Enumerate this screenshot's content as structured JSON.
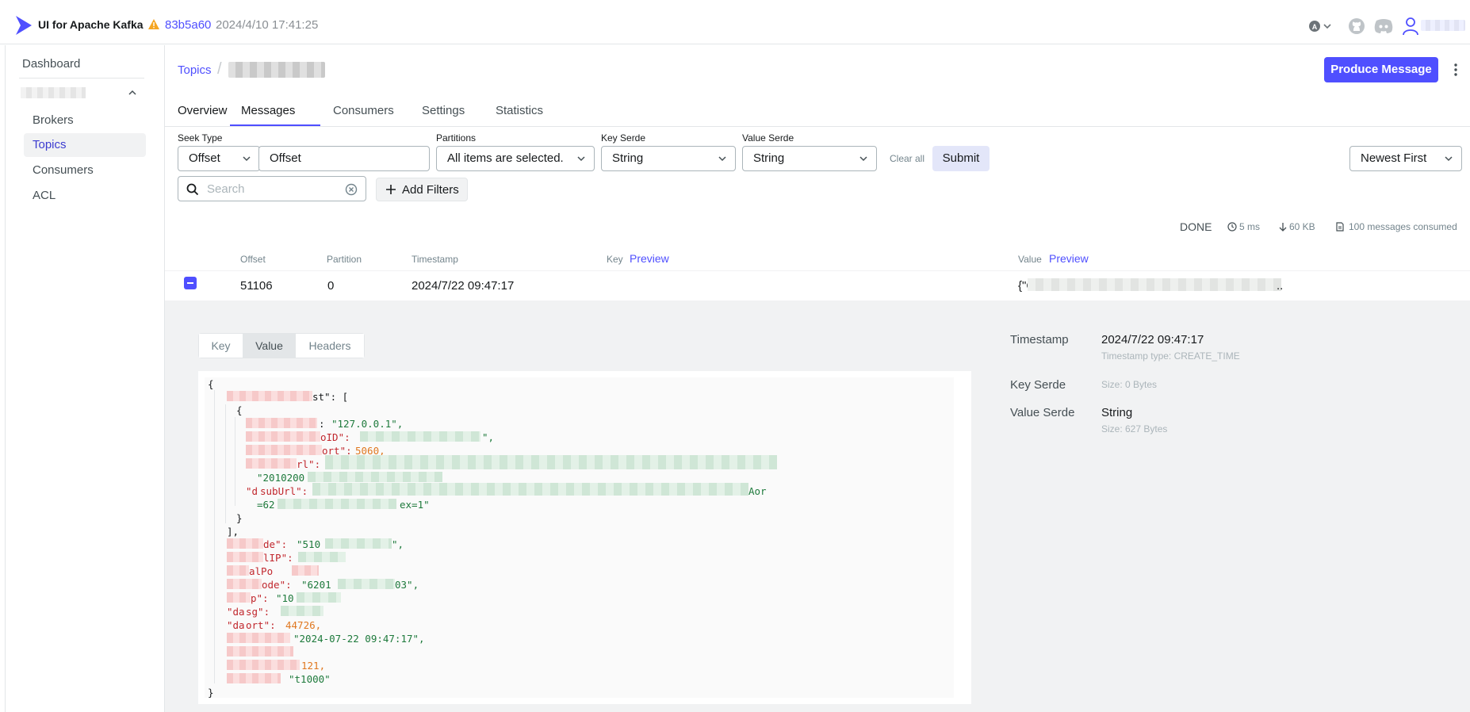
{
  "header": {
    "app_title": "UI for Apache Kafka",
    "commit": "83b5a60",
    "build_date": "2024/4/10 17:41:25",
    "theme_badge": "A"
  },
  "sidebar": {
    "dashboard": "Dashboard",
    "items": [
      {
        "label": "Brokers",
        "active": false
      },
      {
        "label": "Topics",
        "active": true
      },
      {
        "label": "Consumers",
        "active": false
      },
      {
        "label": "ACL",
        "active": false
      }
    ]
  },
  "breadcrumb": {
    "parent": "Topics",
    "separator": "/"
  },
  "actions": {
    "produce": "Produce Message"
  },
  "tabs": [
    {
      "label": "Overview",
      "active": false
    },
    {
      "label": "Messages",
      "active": true
    },
    {
      "label": "Consumers",
      "active": false
    },
    {
      "label": "Settings",
      "active": false
    },
    {
      "label": "Statistics",
      "active": false
    }
  ],
  "filters": {
    "seek_type_label": "Seek Type",
    "seek_type_value": "Offset",
    "seek_input_placeholder": "Offset",
    "partitions_label": "Partitions",
    "partitions_value": "All items are selected.",
    "key_serde_label": "Key Serde",
    "key_serde_value": "String",
    "value_serde_label": "Value Serde",
    "value_serde_value": "String",
    "clear_all": "Clear all",
    "submit": "Submit",
    "sort": "Newest First",
    "search_placeholder": "Search",
    "add_filters": "Add Filters"
  },
  "stats": {
    "status": "DONE",
    "elapsed": "5 ms",
    "size": "60 KB",
    "consumed": "100 messages consumed"
  },
  "table": {
    "columns": {
      "offset": "Offset",
      "partition": "Partition",
      "timestamp": "Timestamp",
      "key": "Key",
      "value": "Value",
      "preview": "Preview"
    },
    "row": {
      "offset": "51106",
      "partition": "0",
      "timestamp": "2024/7/22 09:47:17",
      "value_start": "{\"C",
      "value_end": ".."
    }
  },
  "details": {
    "segments": [
      "Key",
      "Value",
      "Headers"
    ],
    "active_segment": "Value",
    "timestamp_label": "Timestamp",
    "timestamp_value": "2024/7/22 09:47:17",
    "timestamp_type": "Timestamp type: CREATE_TIME",
    "key_serde_label": "Key Serde",
    "key_size": "Size: 0 Bytes",
    "value_serde_label": "Value Serde",
    "value_serde": "String",
    "value_size": "Size: 627 Bytes"
  },
  "json_lines": {
    "l1": "{",
    "l2_tail": "st\": [",
    "l3": "{",
    "l4_val": "\"127.0.0.1\",",
    "l5_key_tail": "oID\": ",
    "l5_end": "\",",
    "l6_key_tail": "ort\": ",
    "l6_val": "5060,",
    "l7_key_tail": "rl\": ",
    "l8_val": "\"2010200",
    "l9_key": "\"d",
    "l9_key_tail": "subUrl\": ",
    "l9_end": "Aor",
    "l10_val": "=62",
    "l10_end": "ex=1\"",
    "l11": "}",
    "l12": "],",
    "l13_key_tail": "de\": ",
    "l13_val": "\"510",
    "l13_end": "\",",
    "l14_key_tail": "lIP\": ",
    "l15_key_tail": "alPo",
    "l16_key_tail": "ode\": ",
    "l16_val": "\"6201",
    "l16_end": "03\",",
    "l17_key_tail": "p\": ",
    "l17_val": "\"10",
    "l18_key": "\"da",
    "l18_key_tail": "sg\": ",
    "l19_key": "\"da",
    "l19_key_tail": "ort\": ",
    "l19_val": "44726,",
    "l20_val": "\"2024-07-22 09:47:17\",",
    "l22_val": "121,",
    "l23_val": "\"t1000\"",
    "l24": "}"
  }
}
